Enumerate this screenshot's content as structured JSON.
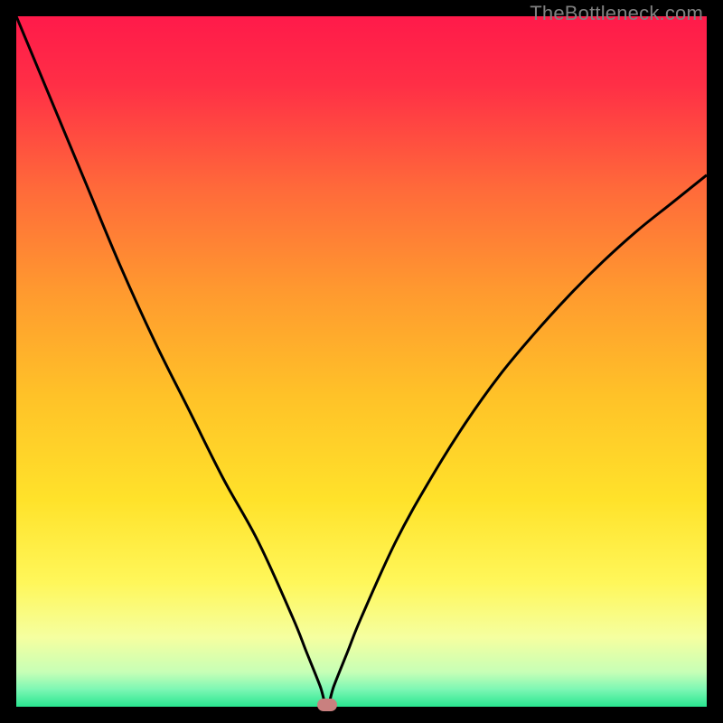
{
  "watermark": "TheBottleneck.com",
  "chart_data": {
    "type": "line",
    "title": "",
    "xlabel": "",
    "ylabel": "",
    "xlim": [
      0,
      100
    ],
    "ylim": [
      0,
      100
    ],
    "grid": false,
    "legend": false,
    "series": [
      {
        "name": "bottleneck-curve",
        "x": [
          0,
          5,
          10,
          15,
          20,
          25,
          30,
          35,
          40,
          42,
          44,
          45,
          46,
          48,
          50,
          55,
          60,
          65,
          70,
          75,
          80,
          85,
          90,
          95,
          100
        ],
        "values": [
          100,
          88,
          76,
          64,
          53,
          43,
          33,
          24,
          13,
          8,
          3,
          0,
          3,
          8,
          13,
          24,
          33,
          41,
          48,
          54,
          59.5,
          64.5,
          69,
          73,
          77
        ]
      }
    ],
    "background_gradient": {
      "stops": [
        {
          "pos": 0.0,
          "color": "#ff1a4a"
        },
        {
          "pos": 0.1,
          "color": "#ff2f46"
        },
        {
          "pos": 0.25,
          "color": "#ff6a3a"
        },
        {
          "pos": 0.4,
          "color": "#ff9a2f"
        },
        {
          "pos": 0.55,
          "color": "#ffc228"
        },
        {
          "pos": 0.7,
          "color": "#ffe22a"
        },
        {
          "pos": 0.82,
          "color": "#fff75a"
        },
        {
          "pos": 0.9,
          "color": "#f5ffa0"
        },
        {
          "pos": 0.95,
          "color": "#c7ffb6"
        },
        {
          "pos": 0.975,
          "color": "#7cf7b4"
        },
        {
          "pos": 1.0,
          "color": "#29e58f"
        }
      ]
    },
    "marker": {
      "x": 45,
      "y": 0,
      "color": "#c9807f"
    }
  }
}
